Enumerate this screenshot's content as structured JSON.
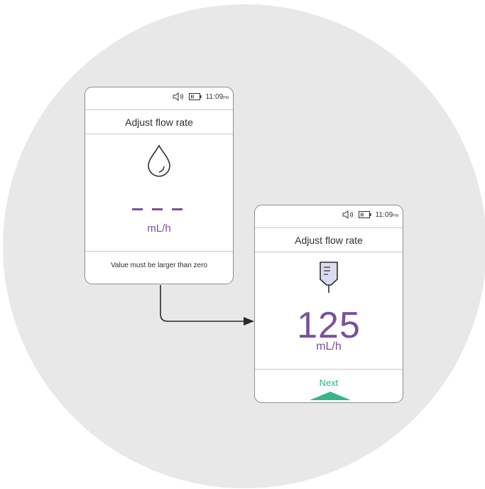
{
  "colors": {
    "background_circle": "#e8e8e9",
    "accent_purple": "#7b4f9e",
    "accent_green": "#36b58c",
    "border": "#8e8e8e"
  },
  "screen_1": {
    "status": {
      "speaker_icon": "speaker-icon",
      "battery_icon": "battery-icon",
      "time": "11:09",
      "ampm": "PM"
    },
    "title": "Adjust flow rate",
    "icon": "droplet-icon",
    "value_placeholder": "---",
    "unit": "mL/h",
    "message": "Value must be larger than zero"
  },
  "screen_2": {
    "status": {
      "speaker_icon": "speaker-icon",
      "battery_icon": "battery-icon",
      "time": "11:09",
      "ampm": "PM"
    },
    "title": "Adjust flow rate",
    "icon": "iv-bag-icon",
    "value": "125",
    "unit": "mL/h",
    "next_label": "Next",
    "next_icon": "up-triangle-icon"
  },
  "connector_icon": "arrow-right-icon"
}
